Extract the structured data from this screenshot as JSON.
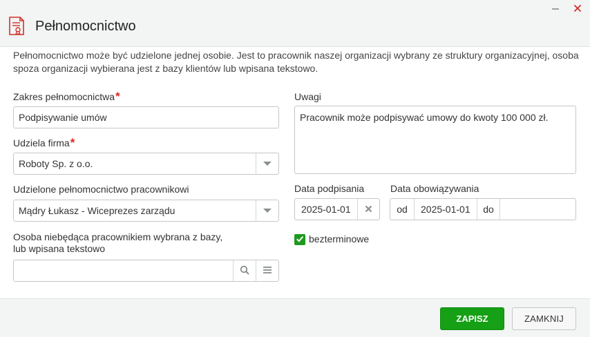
{
  "window": {
    "title": "Pełnomocnictwo",
    "icon": "document-certificate-icon",
    "minimize_icon": "minimize-icon",
    "close_icon": "close-icon"
  },
  "intro_text": "Pełnomocnictwo może być udzielone jednej osobie. Jest to pracownik naszej organizacji wybrany ze struktury organizacyjnej, osoba spoza organizacji wybierana jest z bazy klientów lub wpisana tekstowo.",
  "form": {
    "scope": {
      "label": "Zakres pełnomocnictwa",
      "required_mark": "*",
      "value": "Podpisywanie umów"
    },
    "company": {
      "label": "Udziela firma",
      "required_mark": "*",
      "value": "Roboty Sp. z o.o."
    },
    "employee": {
      "label": "Udzielone pełnomocnictwo pracownikowi",
      "value": "Mądry Łukasz - Wiceprezes zarządu"
    },
    "external_person": {
      "label_line1": "Osoba niebędąca pracownikiem wybrana z bazy,",
      "label_line2": "lub wpisana tekstowo",
      "value": ""
    },
    "notes": {
      "label": "Uwagi",
      "value": "Pracownik może podpisywać umowy do kwoty 100 000 zł."
    },
    "sign_date": {
      "label": "Data podpisania",
      "value": "2025-01-01"
    },
    "validity": {
      "label": "Data obowiązywania",
      "from_label": "od",
      "from_value": "2025-01-01",
      "to_label": "do",
      "to_value": ""
    },
    "indefinite": {
      "label": "bezterminowe",
      "checked": true
    }
  },
  "buttons": {
    "save": "ZAPISZ",
    "close": "ZAMKNIJ"
  },
  "colors": {
    "accent_green": "#15a015",
    "required_red": "#e0261e",
    "icon_red": "#d0302a"
  }
}
